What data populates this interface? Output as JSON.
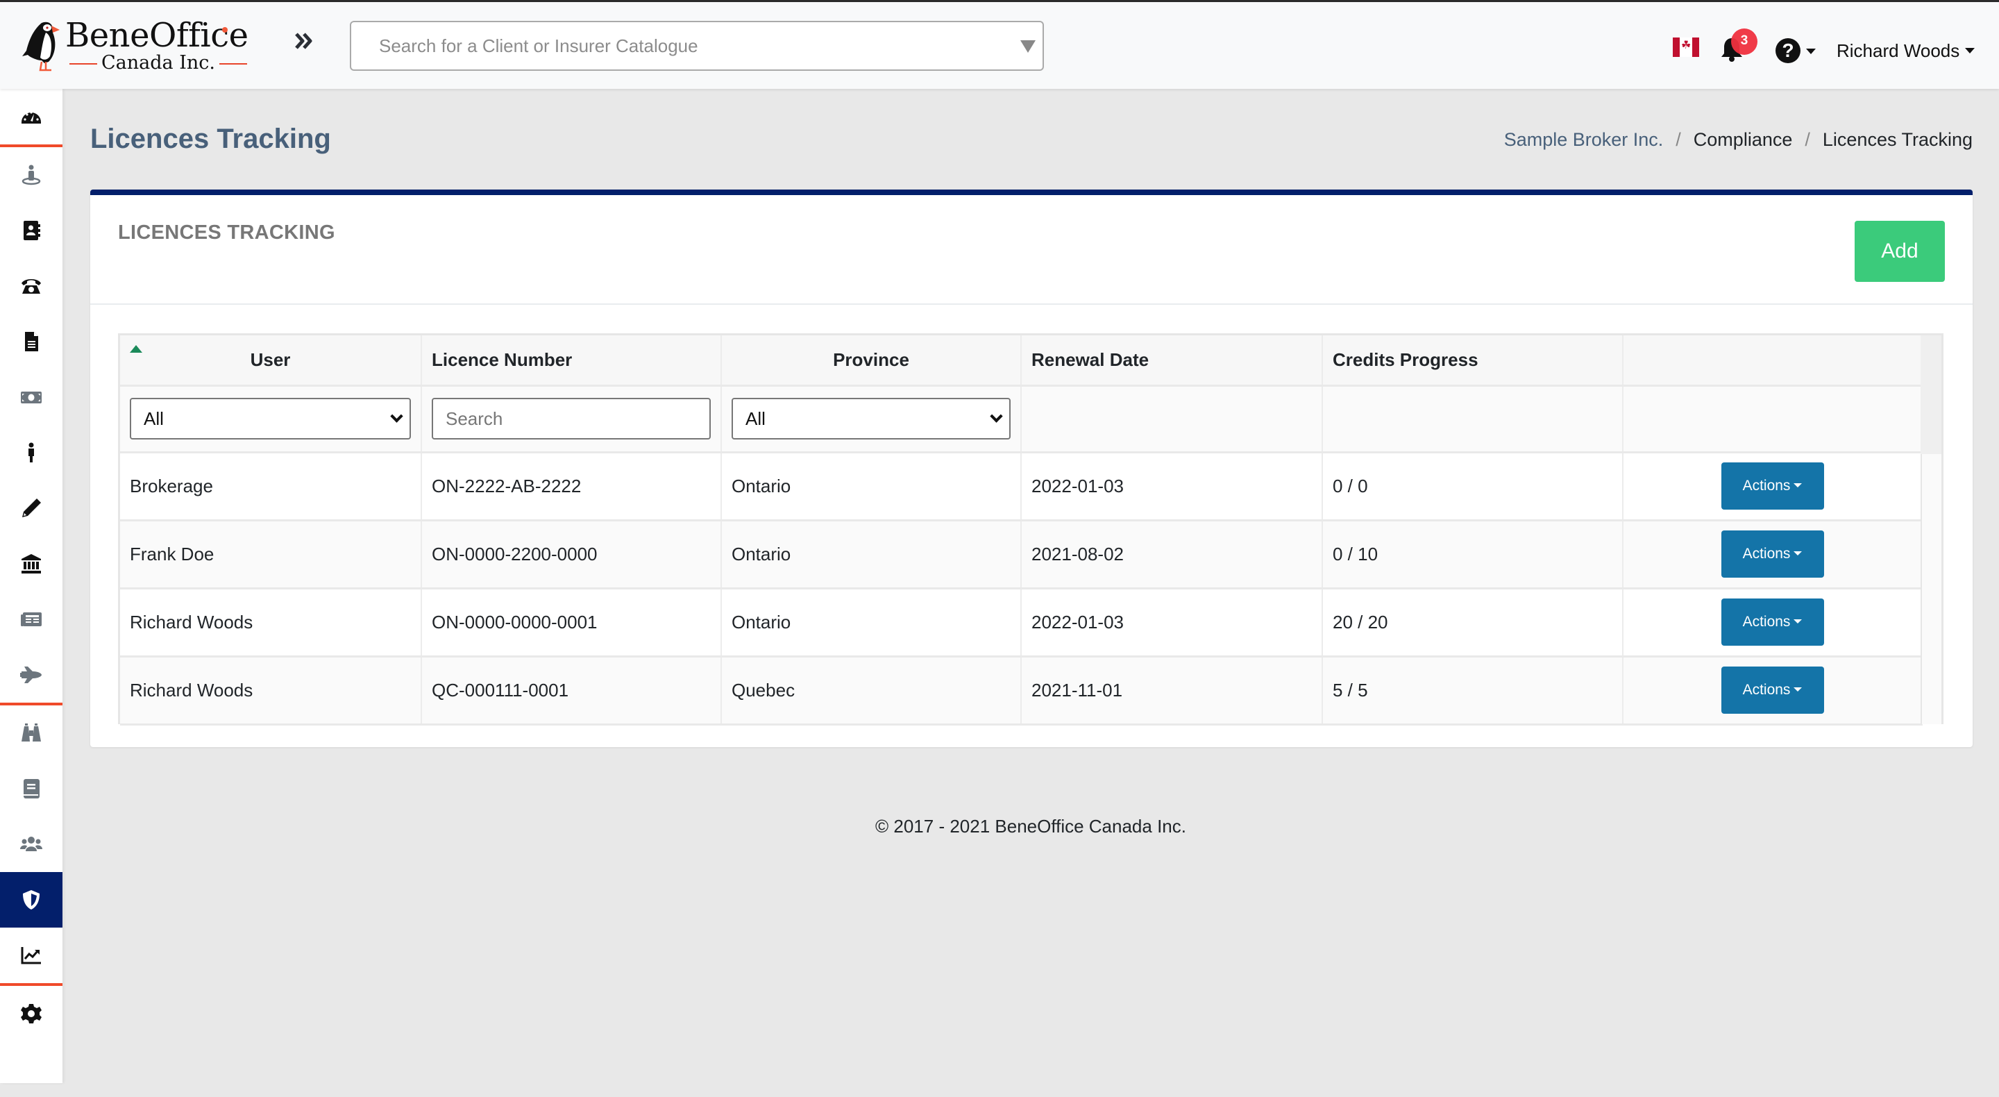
{
  "header": {
    "logo_main": "BeneOffice",
    "logo_sub": "Canada Inc.",
    "expand_icon": "double-chevron-right-icon",
    "search_placeholder": "Search for a Client or Insurer Catalogue",
    "language_flag": "canada-flag-icon",
    "notifications_count": "3",
    "help_icon": "question-circle-icon",
    "user_name": "Richard Woods"
  },
  "sidebar": {
    "items": [
      {
        "icon": "dashboard-gauge-icon",
        "color": "#111111",
        "active": false
      },
      {
        "icon": "client-person-icon",
        "color": "#6c757d",
        "active": false
      },
      {
        "icon": "address-book-icon",
        "color": "#111111",
        "active": false
      },
      {
        "icon": "phone-icon",
        "color": "#111111",
        "active": false
      },
      {
        "icon": "document-icon",
        "color": "#111111",
        "active": false
      },
      {
        "icon": "money-bill-icon",
        "color": "#6c757d",
        "active": false
      },
      {
        "icon": "person-icon",
        "color": "#111111",
        "active": false
      },
      {
        "icon": "pencil-icon",
        "color": "#111111",
        "active": false
      },
      {
        "icon": "bank-icon",
        "color": "#111111",
        "active": false
      },
      {
        "icon": "newspaper-icon",
        "color": "#6c757d",
        "active": false
      },
      {
        "icon": "space-shuttle-icon",
        "color": "#6c757d",
        "active": false
      },
      {
        "icon": "binoculars-icon",
        "color": "#6c757d",
        "active": false
      },
      {
        "icon": "book-icon",
        "color": "#6c757d",
        "active": false
      },
      {
        "icon": "users-icon",
        "color": "#6c757d",
        "active": false
      },
      {
        "icon": "shield-icon",
        "color": "#ffffff",
        "active": true
      },
      {
        "icon": "chart-line-icon",
        "color": "#111111",
        "active": false
      },
      {
        "icon": "gear-icon",
        "color": "#111111",
        "active": false
      }
    ]
  },
  "page": {
    "title": "Licences Tracking",
    "breadcrumb": [
      "Sample Broker Inc.",
      "Compliance",
      "Licences Tracking"
    ]
  },
  "card": {
    "title": "LICENCES TRACKING",
    "add_label": "Add"
  },
  "table": {
    "columns": [
      "User",
      "Licence Number",
      "Province",
      "Renewal Date",
      "Credits Progress",
      ""
    ],
    "sorted_column": "User",
    "sort_direction": "ascending",
    "filters": {
      "user_selected": "All",
      "licence_placeholder": "Search",
      "province_selected": "All"
    },
    "action_label": "Actions",
    "rows": [
      {
        "user": "Brokerage",
        "licence": "ON-2222-AB-2222",
        "province": "Ontario",
        "renewal": "2022-01-03",
        "credits": "0 / 0"
      },
      {
        "user": "Frank Doe",
        "licence": "ON-0000-2200-0000",
        "province": "Ontario",
        "renewal": "2021-08-02",
        "credits": "0 / 10"
      },
      {
        "user": "Richard Woods",
        "licence": "ON-0000-0000-0001",
        "province": "Ontario",
        "renewal": "2022-01-03",
        "credits": "20 / 20"
      },
      {
        "user": "Richard Woods",
        "licence": "QC-000111-0001",
        "province": "Quebec",
        "renewal": "2021-11-01",
        "credits": "5 / 5"
      }
    ]
  },
  "footer": {
    "copyright": "© 2017 - 2021 BeneOffice Canada Inc."
  },
  "colors": {
    "brand_navy": "#031f6b",
    "accent_red": "#f04a2a",
    "add_green": "#3bcb7b",
    "action_blue": "#1474a8",
    "badge_red": "#f0313f",
    "title_slate": "#48607a"
  }
}
